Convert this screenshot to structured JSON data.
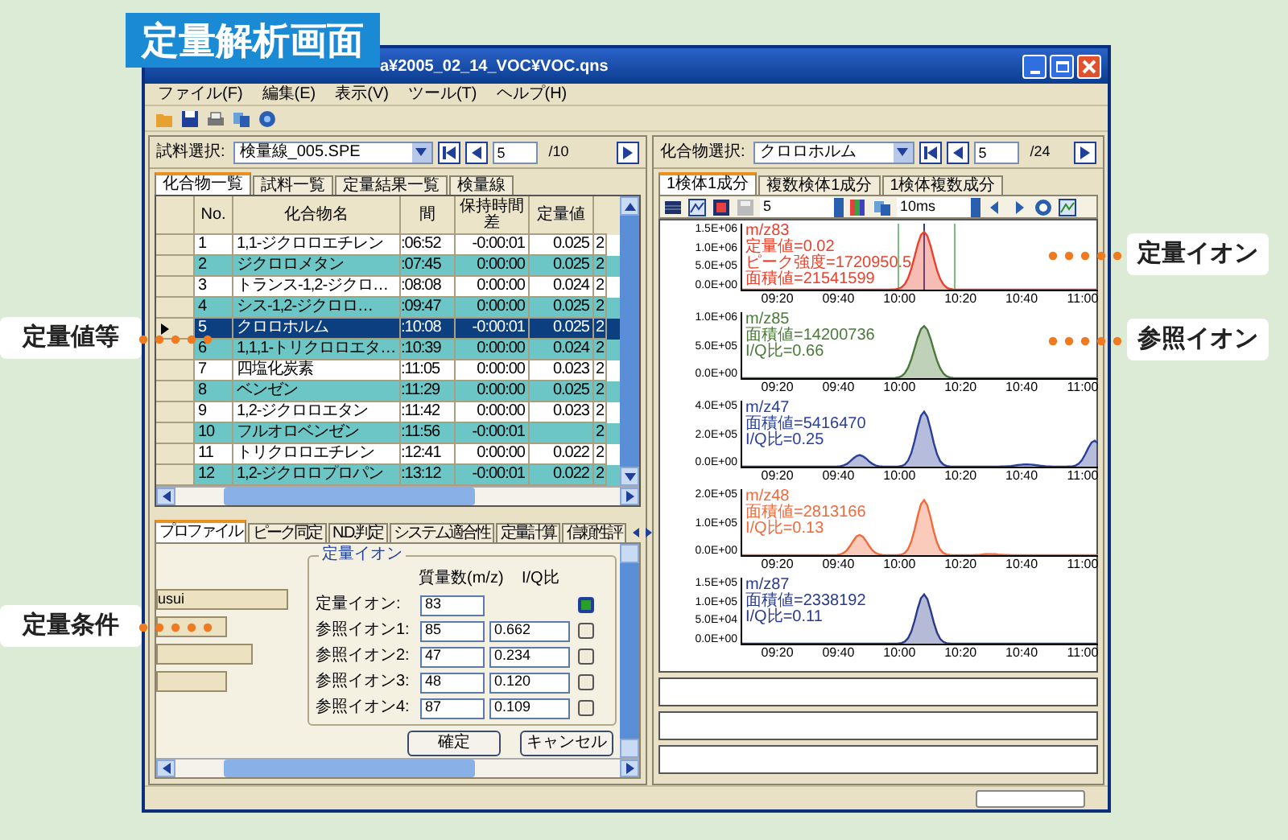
{
  "badge": {
    "text": "定量解析画面"
  },
  "window": {
    "title": "a¥2005_02_14_VOC¥VOC.qns"
  },
  "menu": [
    "ファイル(F)",
    "編集(E)",
    "表示(V)",
    "ツール(T)",
    "ヘルプ(H)"
  ],
  "left_panel": {
    "sample_label": "試料選択:",
    "sample_value": "検量線_005.SPE",
    "index": "5",
    "total": "/10",
    "tabs": [
      {
        "label": "化合物一覧",
        "selected": true
      },
      {
        "label": "試料一覧",
        "selected": false
      },
      {
        "label": "定量結果一覧",
        "selected": false
      },
      {
        "label": "検量線",
        "selected": false
      }
    ],
    "table": {
      "columns": [
        "No.",
        "化合物名",
        "間",
        "保持時間差",
        "定量値"
      ],
      "rows": [
        {
          "no": "1",
          "name": "1,1-ジクロロエチレン",
          "time": ":06:52",
          "difference": "-0:00:01",
          "value": "0.025",
          "column_6": "2",
          "selected": false
        },
        {
          "no": "2",
          "name": "ジクロロメタン",
          "time": ":07:45",
          "difference": "0:00:00",
          "value": "0.025",
          "column_6": "2",
          "selected": false
        },
        {
          "no": "3",
          "name": "トランス-1,2-ジクロ…",
          "time": ":08:08",
          "difference": "0:00:00",
          "value": "0.024",
          "column_6": "2",
          "selected": false
        },
        {
          "no": "4",
          "name": "シス-1,2-ジクロロ…",
          "time": ":09:47",
          "difference": "0:00:00",
          "value": "0.025",
          "column_6": "2",
          "selected": false
        },
        {
          "no": "5",
          "name": "クロロホルム",
          "time": ":10:08",
          "difference": "-0:00:01",
          "value": "0.025",
          "column_6": "2",
          "selected": true
        },
        {
          "no": "6",
          "name": "1,1,1-トリクロロエタ…",
          "time": ":10:39",
          "difference": "0:00:00",
          "value": "0.024",
          "column_6": "2",
          "selected": false
        },
        {
          "no": "7",
          "name": "四塩化炭素",
          "time": ":11:05",
          "difference": "0:00:00",
          "value": "0.023",
          "column_6": "2",
          "selected": false
        },
        {
          "no": "8",
          "name": "ベンゼン",
          "time": ":11:29",
          "difference": "0:00:00",
          "value": "0.025",
          "column_6": "2",
          "selected": false
        },
        {
          "no": "9",
          "name": "1,2-ジクロロエタン",
          "time": ":11:42",
          "difference": "0:00:00",
          "value": "0.023",
          "column_6": "2",
          "selected": false
        },
        {
          "no": "10",
          "name": "フルオロベンゼン",
          "time": ":11:56",
          "difference": "-0:00:01",
          "column_6": "2",
          "selected": false
        },
        {
          "no": "11",
          "name": "トリクロロエチレン",
          "time": ":12:41",
          "difference": "0:00:00",
          "value": "0.022",
          "column_6": "2",
          "selected": false
        },
        {
          "no": "12",
          "name": "1,2-ジクロロプロパン",
          "time": ":13:12",
          "difference": "-0:00:01",
          "value": "0.022",
          "column_6": "2",
          "selected": false
        }
      ]
    },
    "settings_tabs": [
      {
        "label": "プロファイル",
        "selected": true
      },
      {
        "label": "ピーク同定",
        "selected": false
      },
      {
        "label": "N.D.判定",
        "selected": false
      },
      {
        "label": "システム適合性",
        "selected": false
      },
      {
        "label": "定量計算",
        "selected": false
      },
      {
        "label": "信頼性評",
        "selected": false
      }
    ],
    "side_field": "usui",
    "ion_group": {
      "title": "定量イオン",
      "headers": [
        "質量数(m/z)",
        "I/Q比"
      ],
      "rows": [
        {
          "label": "定量イオン:",
          "mz": "83",
          "checked": true
        },
        {
          "label": "参照イオン1:",
          "mz": "85",
          "ratio": "0.662",
          "checked": false
        },
        {
          "label": "参照イオン2:",
          "mz": "47",
          "ratio": "0.234",
          "checked": false
        },
        {
          "label": "参照イオン3:",
          "mz": "48",
          "ratio": "0.120",
          "checked": false
        },
        {
          "label": "参照イオン4:",
          "mz": "87",
          "ratio": "0.109",
          "checked": false
        }
      ]
    },
    "buttons": [
      "確定",
      "キャンセル"
    ]
  },
  "right_panel": {
    "compound_label": "化合物選択:",
    "compound_value": "クロロホルム",
    "index": "5",
    "total": "/24",
    "tabs": [
      {
        "label": "1検体1成分",
        "selected": true
      },
      {
        "label": "複数検体1成分",
        "selected": false
      },
      {
        "label": "1検体複数成分",
        "selected": false
      }
    ],
    "toolbar": {
      "count": "5",
      "interval": "10ms"
    },
    "traces": [
      {
        "color": "#e8412c",
        "lines": [
          "m/z83",
          "定量値=0.02",
          "ピーク強度=1720950.5",
          "面積値=21541599"
        ],
        "y_ticks": [
          "1.5E+06",
          "1.0E+06",
          "5.0E+05",
          "0.0E+00"
        ],
        "x_ticks": [
          "09:20",
          "09:40",
          "10:00",
          "10:20",
          "10:40",
          "11:00"
        ]
      },
      {
        "color": "#4a7a3a",
        "lines": [
          "m/z85",
          "面積値=14200736",
          "I/Q比=0.66"
        ],
        "y_ticks": [
          "1.0E+06",
          "5.0E+05",
          "0.0E+00"
        ],
        "x_ticks": [
          "09:20",
          "09:40",
          "10:00",
          "10:20",
          "10:40",
          "11:00"
        ]
      },
      {
        "color": "#2a3f9a",
        "lines": [
          "m/z47",
          "面積値=5416470",
          "I/Q比=0.25"
        ],
        "y_ticks": [
          "4.0E+05",
          "2.0E+05",
          "0.0E+00"
        ],
        "x_ticks": [
          "09:20",
          "09:40",
          "10:00",
          "10:20",
          "10:40",
          "11:00"
        ]
      },
      {
        "color": "#f06a3c",
        "lines": [
          "m/z48",
          "面積値=2813166",
          "I/Q比=0.13"
        ],
        "y_ticks": [
          "2.0E+05",
          "1.0E+05",
          "0.0E+00"
        ],
        "x_ticks": [
          "09:20",
          "09:40",
          "10:00",
          "10:20",
          "10:40",
          "11:00"
        ]
      },
      {
        "color": "#2a3a8a",
        "lines": [
          "m/z87",
          "面積値=2338192",
          "I/Q比=0.11"
        ],
        "y_ticks": [
          "1.5E+05",
          "1.0E+05",
          "5.0E+04",
          "0.0E+00"
        ],
        "x_ticks": [
          "09:20",
          "09:40",
          "10:00",
          "10:20",
          "10:40",
          "11:00"
        ]
      }
    ]
  },
  "callouts": [
    {
      "text": "定量イオン"
    },
    {
      "text": "定量値等"
    },
    {
      "text": "参照イオン"
    },
    {
      "text": "定量条件"
    }
  ]
}
